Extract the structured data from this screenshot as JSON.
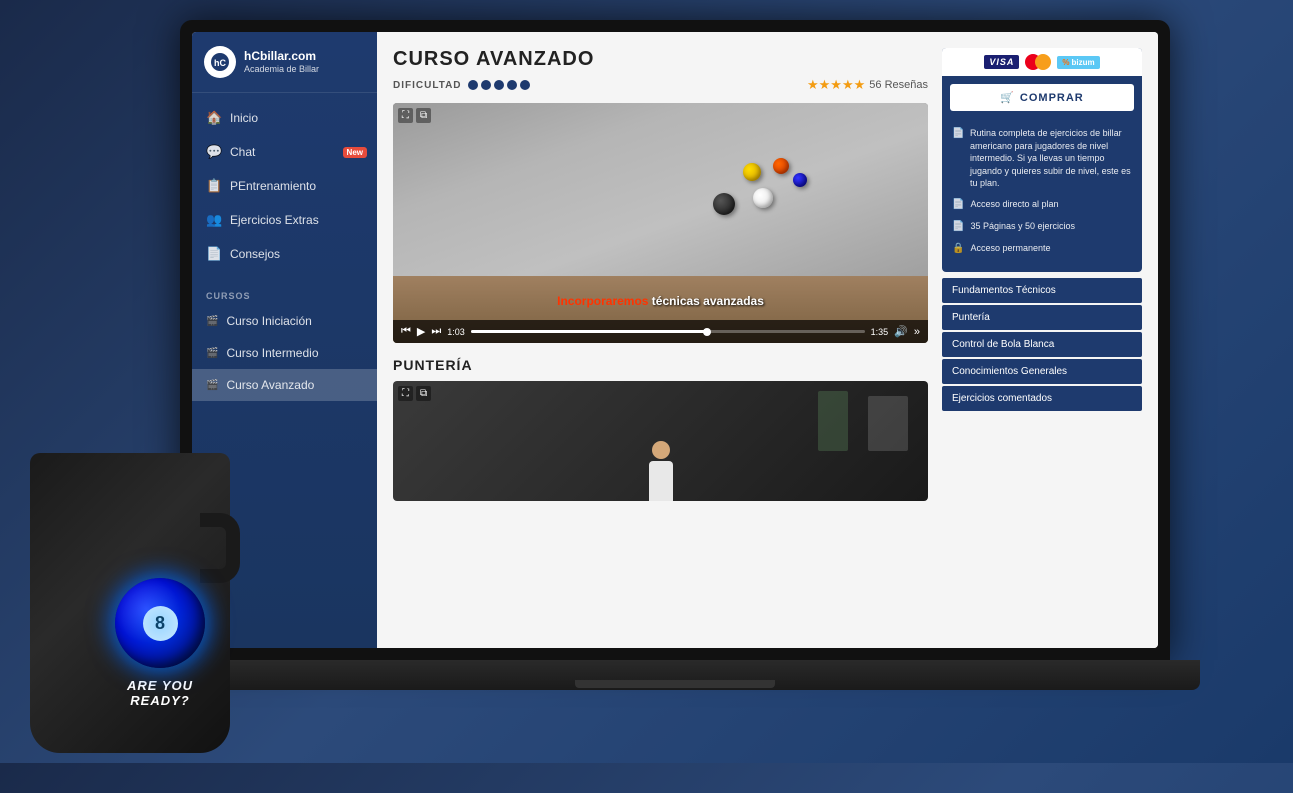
{
  "page": {
    "background": "#1a2a4a"
  },
  "sidebar": {
    "logo": {
      "brand": "hCbillar.com",
      "subtitle": "Academia de Billar"
    },
    "nav_items": [
      {
        "id": "inicio",
        "label": "Inicio",
        "icon": "🏠"
      },
      {
        "id": "chat",
        "label": "Chat",
        "icon": "💬",
        "badge": "New"
      },
      {
        "id": "pentrenamiento",
        "label": "PEntrenamiento",
        "icon": "📋"
      },
      {
        "id": "ejercicios",
        "label": "Ejercicios Extras",
        "icon": "👥"
      },
      {
        "id": "consejos",
        "label": "Consejos",
        "icon": "📄"
      }
    ],
    "section_title": "CURSOS",
    "courses": [
      {
        "id": "iniciacion",
        "label": "Curso Iniciación",
        "active": false
      },
      {
        "id": "intermedio",
        "label": "Curso Intermedio",
        "active": false
      },
      {
        "id": "avanzado",
        "label": "Curso Avanzado",
        "active": true
      }
    ]
  },
  "main": {
    "course_title": "CURSO AVANZADO",
    "difficulty": {
      "label": "DIFICULTAD",
      "dots": 5
    },
    "rating": {
      "stars": "★★★★★",
      "count": "56 Reseñas"
    },
    "video": {
      "subtitle_red": "Incorporaremos",
      "subtitle_white": " técnicas avanzadas",
      "time_current": "1:03",
      "time_total": "1:35"
    },
    "sections": [
      {
        "id": "punteria",
        "label": "PUNTERÍA"
      }
    ],
    "modules": [
      {
        "id": "fundamentos",
        "label": "Fundamentos Técnicos"
      },
      {
        "id": "punteria",
        "label": "Puntería"
      },
      {
        "id": "bola-blanca",
        "label": "Control de Bola Blanca"
      },
      {
        "id": "conocimientos",
        "label": "Conocimientos Generales"
      },
      {
        "id": "ejercicios",
        "label": "Ejercicios comentados"
      }
    ]
  },
  "right_panel": {
    "payment": {
      "visa": "VISA",
      "mastercard": "MC",
      "bizum": "bizum"
    },
    "buy_button": "COMPRAR",
    "features": [
      {
        "icon": "📄",
        "text": "Rutina completa de ejercicios de billar americano para jugadores de nivel intermedio. Si ya llevas un tiempo jugando y quieres subir de nivel, este es tu plan."
      },
      {
        "icon": "📄",
        "text": "Acceso directo al plan"
      },
      {
        "icon": "📄",
        "text": "35 Páginas y 50 ejercicios"
      },
      {
        "icon": "🔒",
        "text": "Acceso permanente"
      }
    ]
  },
  "mug": {
    "ball_number": "8",
    "text_line1": "Are you",
    "text_line2": "Ready?"
  }
}
